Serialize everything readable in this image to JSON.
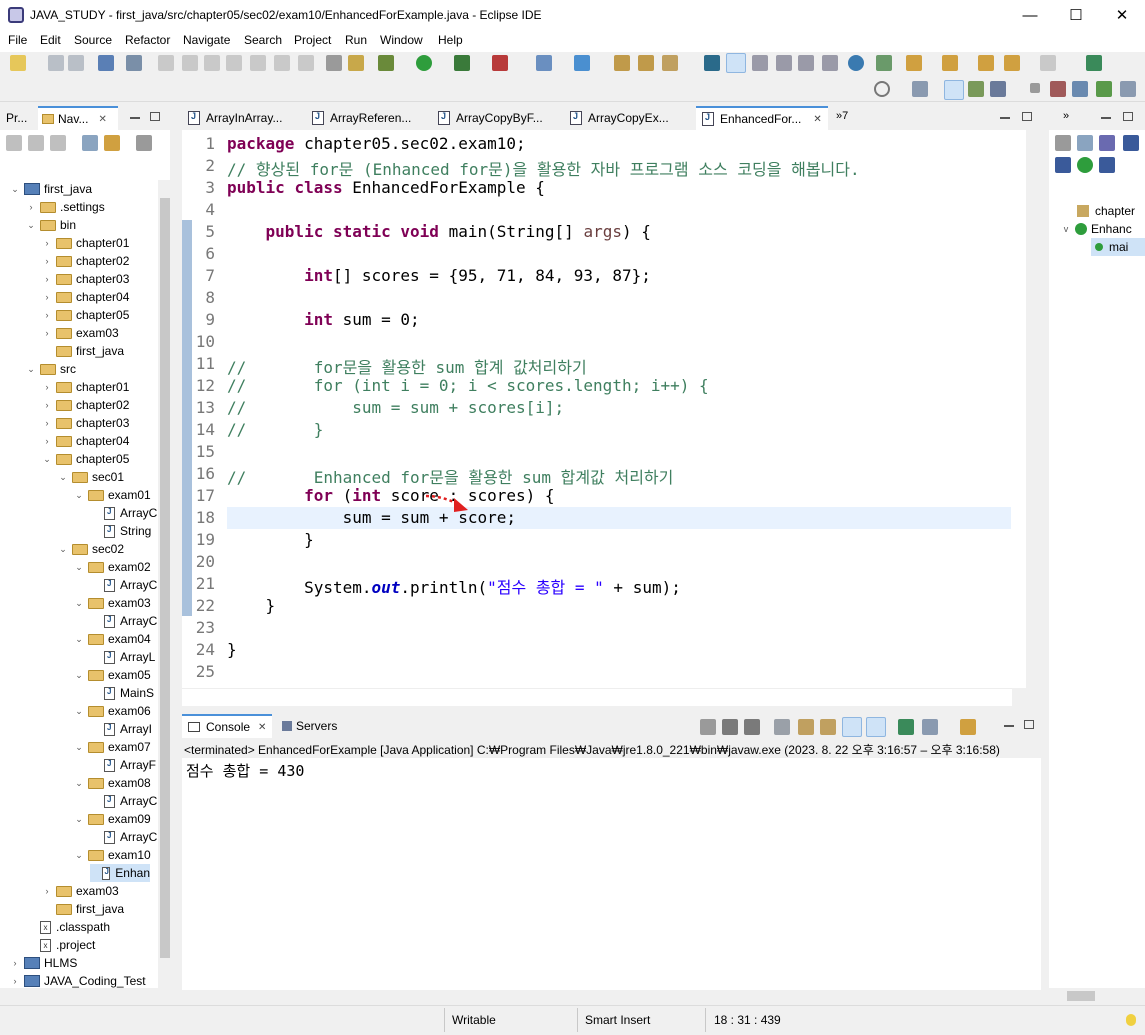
{
  "window": {
    "title": "JAVA_STUDY - first_java/src/chapter05/sec02/exam10/EnhancedForExample.java - Eclipse IDE",
    "minimize": "—",
    "maximize": "☐",
    "close": "✕"
  },
  "menu": [
    "File",
    "Edit",
    "Source",
    "Refactor",
    "Navigate",
    "Search",
    "Project",
    "Run",
    "Window",
    "Help"
  ],
  "left_tabs": {
    "tab1": "Pr...",
    "tab2": "Nav...",
    "close": "✕"
  },
  "tree": [
    {
      "label": "first_java",
      "depth": 0,
      "kind": "project",
      "exp": "v"
    },
    {
      "label": ".settings",
      "depth": 1,
      "kind": "folder",
      "exp": ">"
    },
    {
      "label": "bin",
      "depth": 1,
      "kind": "folder",
      "exp": "v"
    },
    {
      "label": "chapter01",
      "depth": 2,
      "kind": "folder",
      "exp": ">"
    },
    {
      "label": "chapter02",
      "depth": 2,
      "kind": "folder",
      "exp": ">"
    },
    {
      "label": "chapter03",
      "depth": 2,
      "kind": "folder",
      "exp": ">"
    },
    {
      "label": "chapter04",
      "depth": 2,
      "kind": "folder",
      "exp": ">"
    },
    {
      "label": "chapter05",
      "depth": 2,
      "kind": "folder",
      "exp": ">"
    },
    {
      "label": "exam03",
      "depth": 2,
      "kind": "folder",
      "exp": ">"
    },
    {
      "label": "first_java",
      "depth": 2,
      "kind": "folder",
      "exp": ""
    },
    {
      "label": "src",
      "depth": 1,
      "kind": "folder",
      "exp": "v"
    },
    {
      "label": "chapter01",
      "depth": 2,
      "kind": "folder",
      "exp": ">"
    },
    {
      "label": "chapter02",
      "depth": 2,
      "kind": "folder",
      "exp": ">"
    },
    {
      "label": "chapter03",
      "depth": 2,
      "kind": "folder",
      "exp": ">"
    },
    {
      "label": "chapter04",
      "depth": 2,
      "kind": "folder",
      "exp": ">"
    },
    {
      "label": "chapter05",
      "depth": 2,
      "kind": "folder",
      "exp": "v"
    },
    {
      "label": "sec01",
      "depth": 3,
      "kind": "folder",
      "exp": "v"
    },
    {
      "label": "exam01",
      "depth": 4,
      "kind": "folder",
      "exp": "v"
    },
    {
      "label": "ArrayC",
      "depth": 5,
      "kind": "java",
      "exp": ""
    },
    {
      "label": "String",
      "depth": 5,
      "kind": "java",
      "exp": ""
    },
    {
      "label": "sec02",
      "depth": 3,
      "kind": "folder",
      "exp": "v"
    },
    {
      "label": "exam02",
      "depth": 4,
      "kind": "folder",
      "exp": "v"
    },
    {
      "label": "ArrayC",
      "depth": 5,
      "kind": "java",
      "exp": ""
    },
    {
      "label": "exam03",
      "depth": 4,
      "kind": "folder",
      "exp": "v"
    },
    {
      "label": "ArrayC",
      "depth": 5,
      "kind": "java",
      "exp": ""
    },
    {
      "label": "exam04",
      "depth": 4,
      "kind": "folder",
      "exp": "v"
    },
    {
      "label": "ArrayL",
      "depth": 5,
      "kind": "java",
      "exp": ""
    },
    {
      "label": "exam05",
      "depth": 4,
      "kind": "folder",
      "exp": "v"
    },
    {
      "label": "MainS",
      "depth": 5,
      "kind": "java",
      "exp": ""
    },
    {
      "label": "exam06",
      "depth": 4,
      "kind": "folder",
      "exp": "v"
    },
    {
      "label": "ArrayI",
      "depth": 5,
      "kind": "java",
      "exp": ""
    },
    {
      "label": "exam07",
      "depth": 4,
      "kind": "folder",
      "exp": "v"
    },
    {
      "label": "ArrayF",
      "depth": 5,
      "kind": "java",
      "exp": ""
    },
    {
      "label": "exam08",
      "depth": 4,
      "kind": "folder",
      "exp": "v"
    },
    {
      "label": "ArrayC",
      "depth": 5,
      "kind": "java",
      "exp": ""
    },
    {
      "label": "exam09",
      "depth": 4,
      "kind": "folder",
      "exp": "v"
    },
    {
      "label": "ArrayC",
      "depth": 5,
      "kind": "java",
      "exp": ""
    },
    {
      "label": "exam10",
      "depth": 4,
      "kind": "folder",
      "exp": "v"
    },
    {
      "label": "Enhan",
      "depth": 5,
      "kind": "java",
      "exp": "",
      "selected": true
    },
    {
      "label": "exam03",
      "depth": 2,
      "kind": "folder",
      "exp": ">"
    },
    {
      "label": "first_java",
      "depth": 2,
      "kind": "folder",
      "exp": ""
    },
    {
      "label": ".classpath",
      "depth": 1,
      "kind": "xml",
      "exp": ""
    },
    {
      "label": ".project",
      "depth": 1,
      "kind": "xml",
      "exp": ""
    },
    {
      "label": "HLMS",
      "depth": 0,
      "kind": "project",
      "exp": ">"
    },
    {
      "label": "JAVA_Coding_Test",
      "depth": 0,
      "kind": "project",
      "exp": ">"
    }
  ],
  "editor_tabs": [
    {
      "label": "ArrayInArray...",
      "active": false
    },
    {
      "label": "ArrayReferen...",
      "active": false
    },
    {
      "label": "ArrayCopyByF...",
      "active": false
    },
    {
      "label": "ArrayCopyEx...",
      "active": false
    },
    {
      "label": "EnhancedFor...",
      "active": true
    }
  ],
  "editor_overflow": "»7",
  "code_lines": [
    "package chapter05.sec02.exam10;",
    "// 향상된 for문 (Enhanced for문)을 활용한 자바 프로그램 소스 코딩을 해봅니다.",
    "public class EnhancedForExample {",
    "",
    "    public static void main(String[] args) {",
    "",
    "        int[] scores = {95, 71, 84, 93, 87};",
    "",
    "        int sum = 0;",
    "",
    "//       for문을 활용한 sum 합계 값처리하기",
    "//       for (int i = 0; i < scores.length; i++) {",
    "//           sum = sum + scores[i];",
    "//       }",
    "",
    "//       Enhanced for문을 활용한 sum 합계값 처리하기",
    "        for (int score : scores) {",
    "            sum = sum + score;",
    "        }",
    "",
    "        System.out.println(\"점수 총합 = \" + sum);",
    "    }",
    "",
    "}",
    ""
  ],
  "console": {
    "tab": "Console",
    "servers_tab": "Servers",
    "status": "<terminated> EnhancedForExample [Java Application] C:₩Program Files₩Java₩jre1.8.0_221₩bin₩javaw.exe  (2023. 8. 22 오후 3:16:57 – 오후 3:16:58)",
    "output": "점수 총합 = 430"
  },
  "outline": {
    "items": [
      "chapter",
      "Enhanc",
      "mai"
    ]
  },
  "status": {
    "writable": "Writable",
    "insert": "Smart Insert",
    "position": "18 : 31 : 439"
  },
  "colors": {
    "keyword": "#7f0055",
    "comment": "#3f7f5f",
    "string": "#2a00ff",
    "current_line": "#e8f2fe",
    "arrow": "#e02020"
  }
}
